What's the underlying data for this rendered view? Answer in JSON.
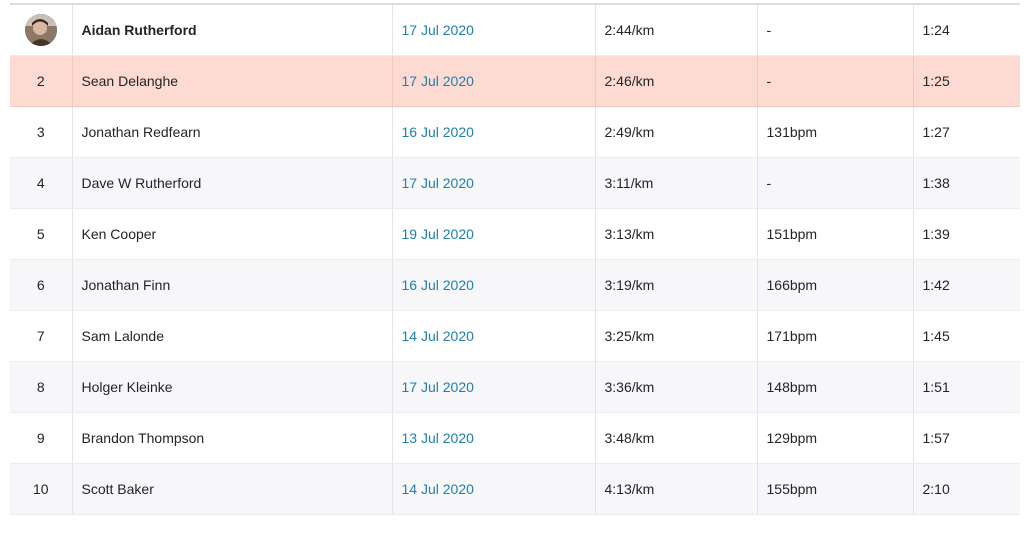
{
  "leaderboard": {
    "current_athlete_index": 0,
    "colors": {
      "highlight_row": "#fddbd2",
      "link": "#1f7fb0",
      "stripe": "#f7f7fa"
    },
    "rows": [
      {
        "rank": "",
        "athlete": "Aidan Rutherford",
        "date": "17 Jul 2020",
        "pace": "2:44/km",
        "heart_rate": "-",
        "time": "1:24",
        "avatar": "athlete-avatar-icon"
      },
      {
        "rank": "2",
        "athlete": "Sean Delanghe",
        "date": "17 Jul 2020",
        "pace": "2:46/km",
        "heart_rate": "-",
        "time": "1:25"
      },
      {
        "rank": "3",
        "athlete": "Jonathan Redfearn",
        "date": "16 Jul 2020",
        "pace": "2:49/km",
        "heart_rate": "131bpm",
        "time": "1:27"
      },
      {
        "rank": "4",
        "athlete": "Dave W Rutherford",
        "date": "17 Jul 2020",
        "pace": "3:11/km",
        "heart_rate": "-",
        "time": "1:38"
      },
      {
        "rank": "5",
        "athlete": "Ken Cooper",
        "date": "19 Jul 2020",
        "pace": "3:13/km",
        "heart_rate": "151bpm",
        "time": "1:39"
      },
      {
        "rank": "6",
        "athlete": "Jonathan Finn",
        "date": "16 Jul 2020",
        "pace": "3:19/km",
        "heart_rate": "166bpm",
        "time": "1:42"
      },
      {
        "rank": "7",
        "athlete": "Sam Lalonde",
        "date": "14 Jul 2020",
        "pace": "3:25/km",
        "heart_rate": "171bpm",
        "time": "1:45"
      },
      {
        "rank": "8",
        "athlete": "Holger Kleinke",
        "date": "17 Jul 2020",
        "pace": "3:36/km",
        "heart_rate": "148bpm",
        "time": "1:51"
      },
      {
        "rank": "9",
        "athlete": "Brandon Thompson",
        "date": "13 Jul 2020",
        "pace": "3:48/km",
        "heart_rate": "129bpm",
        "time": "1:57"
      },
      {
        "rank": "10",
        "athlete": "Scott Baker",
        "date": "14 Jul 2020",
        "pace": "4:13/km",
        "heart_rate": "155bpm",
        "time": "2:10"
      }
    ]
  }
}
